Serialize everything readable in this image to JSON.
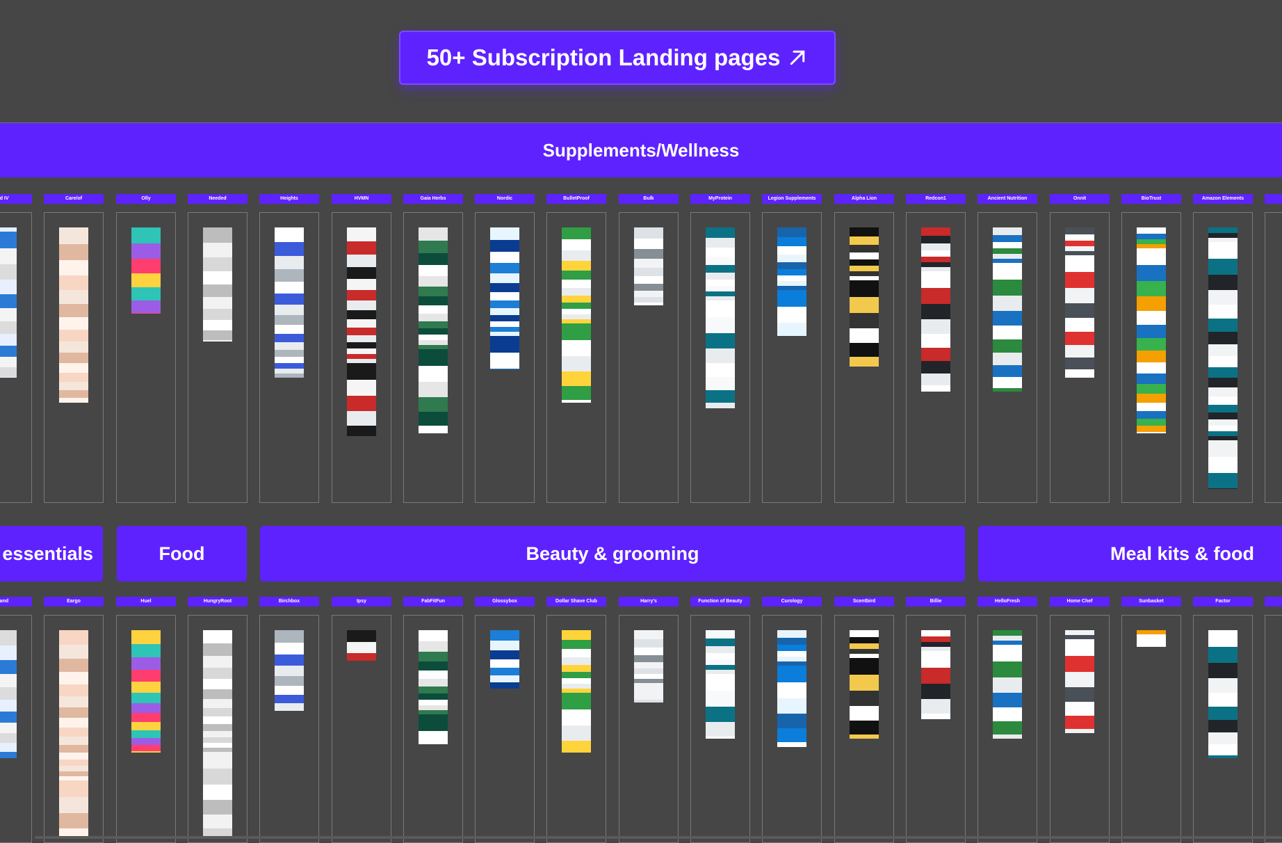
{
  "cta": {
    "label": "50+ Subscription Landing pages",
    "icon": "arrow-up-right-icon",
    "color": "#5e22ff"
  },
  "accent": "#5e22ff",
  "sections": {
    "supplements": {
      "title": "Supplements/Wellness",
      "columns": [
        "uid IV",
        "Care/of",
        "Olly",
        "Needed",
        "Heights",
        "HVMN",
        "Gaia Herbs",
        "Nordic",
        "BulletProof",
        "Bulk",
        "MyProtein",
        "Legion Supplements",
        "Alpha Lion",
        "Redcon1",
        "Ancient Nutrition",
        "Onnit",
        "BioTrust",
        "Amazon Elements"
      ]
    },
    "categories": [
      "essentials",
      "Food",
      "Beauty & grooming",
      "Meal kits & food"
    ],
    "bottom": {
      "columns": [
        "eland",
        "Eargo",
        "Huel",
        "HungryRoot",
        "Birchbox",
        "Ipsy",
        "FabFitFun",
        "Glossybox",
        "Dollar Shave Club",
        "Harry's",
        "Function of Beauty",
        "Curology",
        "Scentbird",
        "Billie",
        "HelloFresh",
        "Home Chef",
        "Sunbasket",
        "Factor"
      ]
    }
  }
}
